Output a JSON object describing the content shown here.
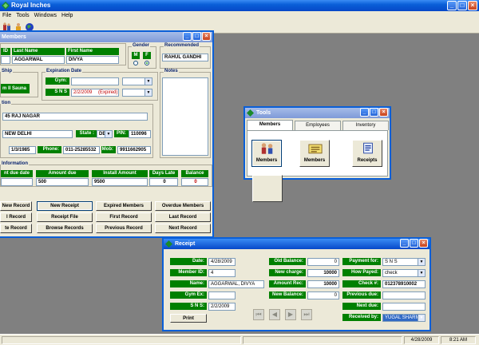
{
  "app": {
    "title": "Royal Inches"
  },
  "menu": [
    "File",
    "Tools",
    "Windows",
    "Help"
  ],
  "members": {
    "title": "Members",
    "name": {
      "id_label": "ID",
      "last_label": "Last Name",
      "first_label": "First Name",
      "last": "AGGARWAL",
      "first": "DIVYA"
    },
    "gender": {
      "label": "Gender",
      "m": "M",
      "f": "F"
    },
    "recommended": {
      "label": "Recommended",
      "value": "RAHUL GANDHI"
    },
    "membership": {
      "label": "Ship",
      "value": "m II Sauna"
    },
    "expiration": {
      "label": "Expiration Date",
      "gym_label": "Gym:",
      "sns_label": "S N S",
      "sns_value": "2/2/2009",
      "expired": "(Expired)"
    },
    "notes_label": "Notes",
    "address": {
      "label": "tion",
      "line1": "45 RAJ NAGAR",
      "city": "NEW DELHI",
      "state_label": "State :",
      "state": "DE",
      "pin_label": "PIN:",
      "pin": "110096",
      "dob": "1/3/1985",
      "phone_label": "Phone:",
      "phone": "011-25285532",
      "mob_label": "Mob:",
      "mob": "9911662905"
    },
    "payment": {
      "label": "Information",
      "cols": [
        "nt due date",
        "Amount due",
        "Install Amount",
        "Days Late",
        "Balance"
      ],
      "amount_due": "500",
      "install": "9500",
      "days_late": "0",
      "balance": "0"
    },
    "buttons": [
      [
        "New Record",
        "New Receipt",
        "Expired Members",
        "Overdue Members"
      ],
      [
        "l Record",
        "Receipt File",
        "First Record",
        "Last Record"
      ],
      [
        "te Record",
        "Browse Records",
        "Previous Record",
        "Next Record"
      ]
    ]
  },
  "tools": {
    "title": "Tools",
    "tabs": [
      "Members",
      "Employees",
      "Inventory"
    ],
    "items": [
      "Members",
      "Members",
      "Receipts"
    ]
  },
  "receipt": {
    "title": "Receipt",
    "date_label": "Date:",
    "date": "4/28/2009",
    "member_id_label": "Member ID:",
    "member_id": "4",
    "name_label": "Name:",
    "name": "AGGARWAL, DIVYA",
    "gym_label": "Gym Ex:",
    "gym": "",
    "sns_label": "S N S:",
    "sns": "2/2/2009",
    "old_balance_label": "Old Balance:",
    "old_balance": "0",
    "new_charge_label": "New charge:",
    "new_charge": "10000",
    "amount_rec_label": "Amount Rec:",
    "amount_rec": "10000",
    "new_balance_label": "New Balance:",
    "new_balance": "0",
    "payment_for_label": "Payment for:",
    "payment_for": "S N S",
    "how_payed_label": "How Payed:",
    "how_payed": "check",
    "check_label": "Check #:",
    "check": "012378910002",
    "prev_due_label": "Previous due:",
    "prev_due": "",
    "next_due_label": "Next due:",
    "next_due": "",
    "received_label": "Received by:",
    "received": "YUGAL SHARMA",
    "print_label": "Print"
  },
  "taskbar": {
    "date": "4/28/2009",
    "time": "8:21 AM"
  },
  "colors": {
    "title": "#0a5fd8",
    "label_green": "#008000"
  }
}
